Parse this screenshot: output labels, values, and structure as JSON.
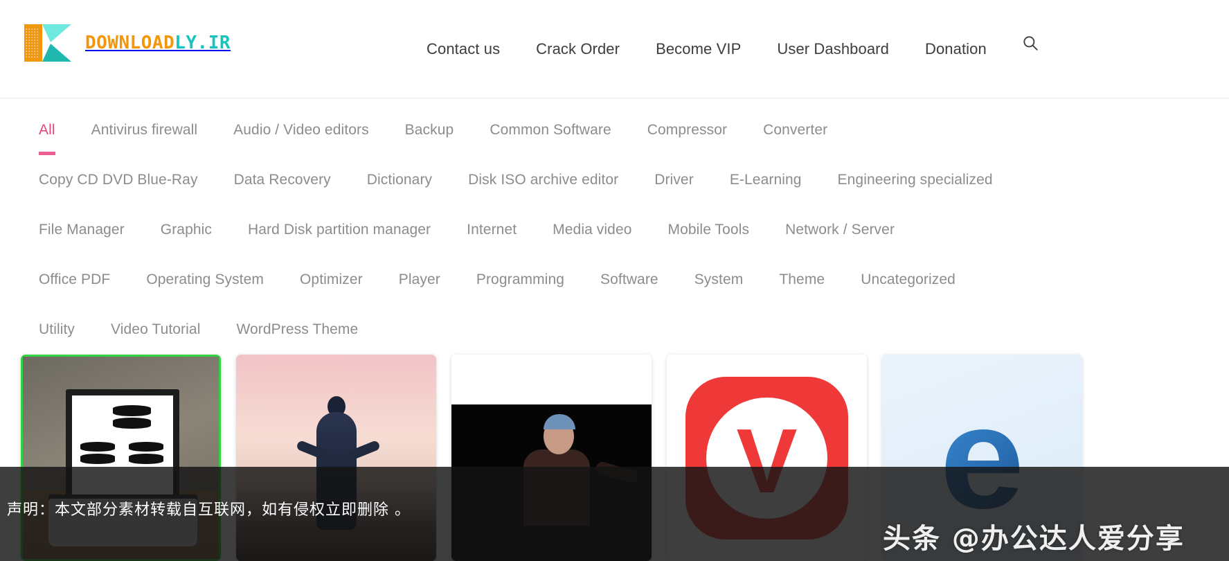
{
  "site": {
    "logo_text_part1": "DOWNLOAD",
    "logo_text_part2": "LY.IR",
    "logo_icon": "play-button-logo-icon"
  },
  "topnav": {
    "items": [
      {
        "label": "Contact us"
      },
      {
        "label": "Crack Order"
      },
      {
        "label": "Become VIP"
      },
      {
        "label": "User Dashboard"
      },
      {
        "label": "Donation"
      }
    ],
    "search_icon": "search-icon"
  },
  "categories": {
    "active": "All",
    "rows": [
      [
        {
          "label": "All",
          "active": true
        },
        {
          "label": "Antivirus firewall",
          "active": false
        },
        {
          "label": "Audio / Video editors",
          "active": false
        },
        {
          "label": "Backup",
          "active": false
        },
        {
          "label": "Common Software",
          "active": false
        },
        {
          "label": "Compressor",
          "active": false
        },
        {
          "label": "Converter",
          "active": false
        }
      ],
      [
        {
          "label": "Copy CD DVD Blue-Ray",
          "active": false
        },
        {
          "label": "Data Recovery",
          "active": false
        },
        {
          "label": "Dictionary",
          "active": false
        },
        {
          "label": "Disk ISO archive editor",
          "active": false
        },
        {
          "label": "Driver",
          "active": false
        },
        {
          "label": "E-Learning",
          "active": false
        },
        {
          "label": "Engineering specialized",
          "active": false
        }
      ],
      [
        {
          "label": "File Manager",
          "active": false
        },
        {
          "label": "Graphic",
          "active": false
        },
        {
          "label": "Hard Disk partition manager",
          "active": false
        },
        {
          "label": "Internet",
          "active": false
        },
        {
          "label": "Media video",
          "active": false
        },
        {
          "label": "Mobile Tools",
          "active": false
        },
        {
          "label": "Network / Server",
          "active": false
        }
      ],
      [
        {
          "label": "Office PDF",
          "active": false
        },
        {
          "label": "Operating System",
          "active": false
        },
        {
          "label": "Optimizer",
          "active": false
        },
        {
          "label": "Player",
          "active": false
        },
        {
          "label": "Programming",
          "active": false
        },
        {
          "label": "Software",
          "active": false
        },
        {
          "label": "System",
          "active": false
        },
        {
          "label": "Theme",
          "active": false
        },
        {
          "label": "Uncategorized",
          "active": false
        }
      ],
      [
        {
          "label": "Utility",
          "active": false
        },
        {
          "label": "Video Tutorial",
          "active": false
        },
        {
          "label": "WordPress Theme",
          "active": false
        }
      ]
    ]
  },
  "cards": [
    {
      "name": "database-desk-photo-thumbnail",
      "variant": "c1"
    },
    {
      "name": "sci-fi-figure-thumbnail",
      "variant": "c2"
    },
    {
      "name": "speaker-portrait-thumbnail",
      "variant": "c3"
    },
    {
      "name": "vivaldi-browser-logo-thumbnail",
      "variant": "c4",
      "glyph": "V"
    },
    {
      "name": "microsoft-edge-logo-thumbnail",
      "variant": "c5",
      "glyph": "e"
    }
  ],
  "overlay": {
    "disclaimer": "声明：本文部分素材转载自互联网，如有侵权立即删除 。",
    "watermark": "头条 @办公达人爱分享"
  },
  "colors": {
    "accent_pink": "#e8457c",
    "logo_orange": "#F2960B",
    "logo_teal": "#18C5BE",
    "nav_text": "#3d3d3d",
    "category_text": "#8c8c8c"
  }
}
